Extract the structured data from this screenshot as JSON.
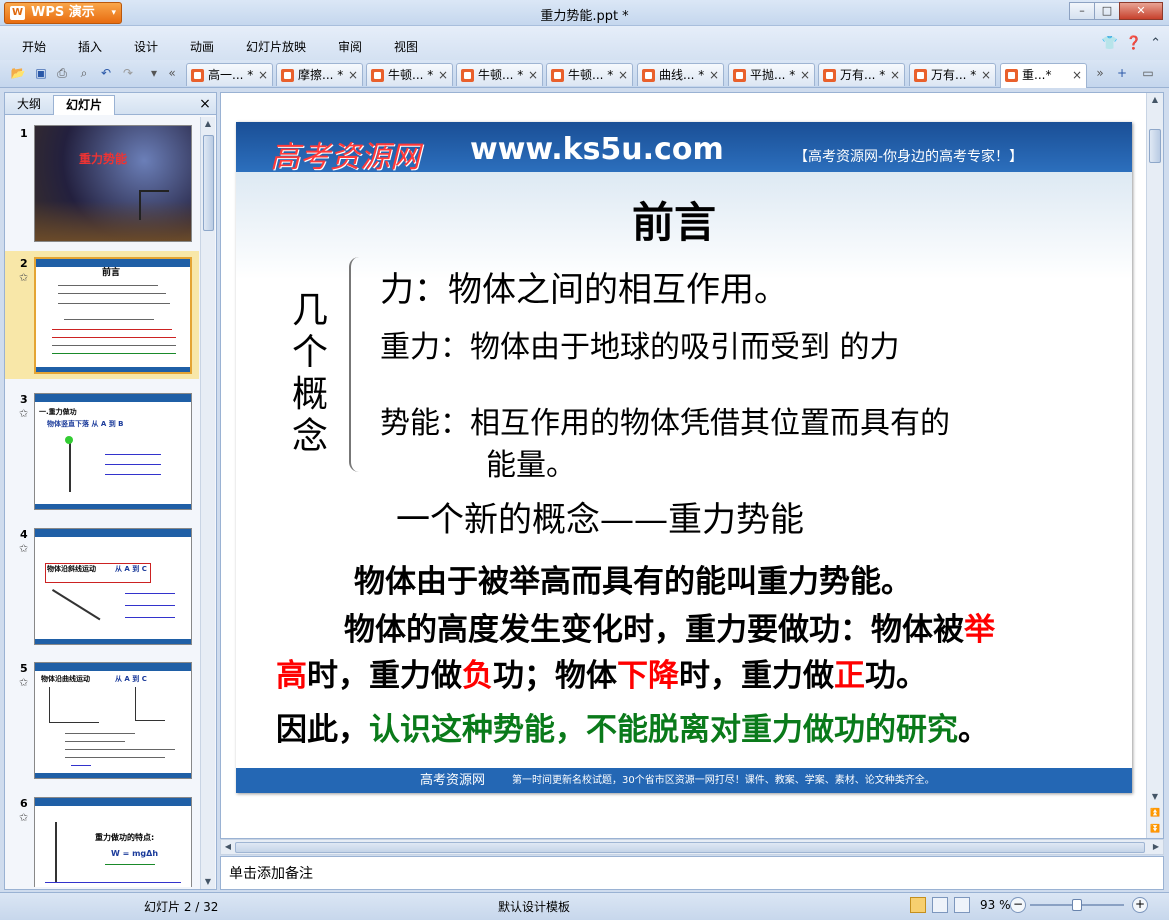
{
  "app": {
    "name": "WPS 演示",
    "window_title": "重力势能.ppt *"
  },
  "menu": [
    "开始",
    "插入",
    "设计",
    "动画",
    "幻灯片放映",
    "审阅",
    "视图"
  ],
  "doc_tabs": [
    {
      "label": "高一...",
      "dirty": "*"
    },
    {
      "label": "摩擦...",
      "dirty": "*"
    },
    {
      "label": "牛顿...",
      "dirty": "*"
    },
    {
      "label": "牛顿...",
      "dirty": "*"
    },
    {
      "label": "牛顿...",
      "dirty": "*"
    },
    {
      "label": "曲线...",
      "dirty": "*"
    },
    {
      "label": "平抛...",
      "dirty": "*"
    },
    {
      "label": "万有...",
      "dirty": "*"
    },
    {
      "label": "万有...",
      "dirty": "*"
    },
    {
      "label": "重...",
      "dirty": "*"
    }
  ],
  "panel": {
    "tab_outline": "大纲",
    "tab_slides": "幻灯片",
    "close": "×"
  },
  "thumbnails": [
    {
      "num": "1",
      "title": "重力势能"
    },
    {
      "num": "2",
      "title": "前言"
    },
    {
      "num": "3",
      "title": "一.重力做功",
      "sub": "物体竖直下落   从 A 到 B"
    },
    {
      "num": "4",
      "title": "物体沿斜线运动",
      "sub": "从 A 到 C"
    },
    {
      "num": "5",
      "title": "物体沿曲线运动",
      "sub": "从 A 到 C"
    },
    {
      "num": "6",
      "title": "重力做功的特点:",
      "sub": "W = mgΔh"
    }
  ],
  "slide": {
    "site_name": "高考资源网",
    "site_url": "www.ks5u.com",
    "site_slogan": "【高考资源网-你身边的高考专家！】",
    "title": "前言",
    "vertical_label": "几个概念",
    "line1": "力：物体之间的相互作用。",
    "line2": "重力：物体由于地球的吸引而受到 的力",
    "line3a": "势能：相互作用的物体凭借其位置而具有的",
    "line3b": "能量。",
    "new_concept": "一个新的概念——重力势能",
    "p1": "物体由于被举高而具有的能叫重力势能。",
    "p2a_1": "物体的高度发生变化时，重力要做功：物体被",
    "p2a_red": "举",
    "p2b_red1": "高",
    "p2b_1": "时，重力做",
    "p2b_red2": "负",
    "p2b_2": "功；物体",
    "p2b_red3": "下降",
    "p2b_3": "时，重力做",
    "p2b_red4": "正",
    "p2b_4": "功。",
    "p3_1": "因此，",
    "p3_green": "认识这种势能，不能脱离对重力做功的研究",
    "p3_2": "。",
    "footer_site": "高考资源网",
    "footer_text": "第一时间更新名校试题，30个省市区资源一网打尽！课件、教案、学案、素材、论文种类齐全。"
  },
  "notes_placeholder": "单击添加备注",
  "status": {
    "slide_counter": "幻灯片 2 / 32",
    "template": "默认设计模板",
    "zoom": "93 %"
  },
  "colors": {
    "banner": "#1f5fa6",
    "accent_red": "#ff0000",
    "accent_green": "#0a7a1a",
    "app_orange": "#f08a24"
  }
}
